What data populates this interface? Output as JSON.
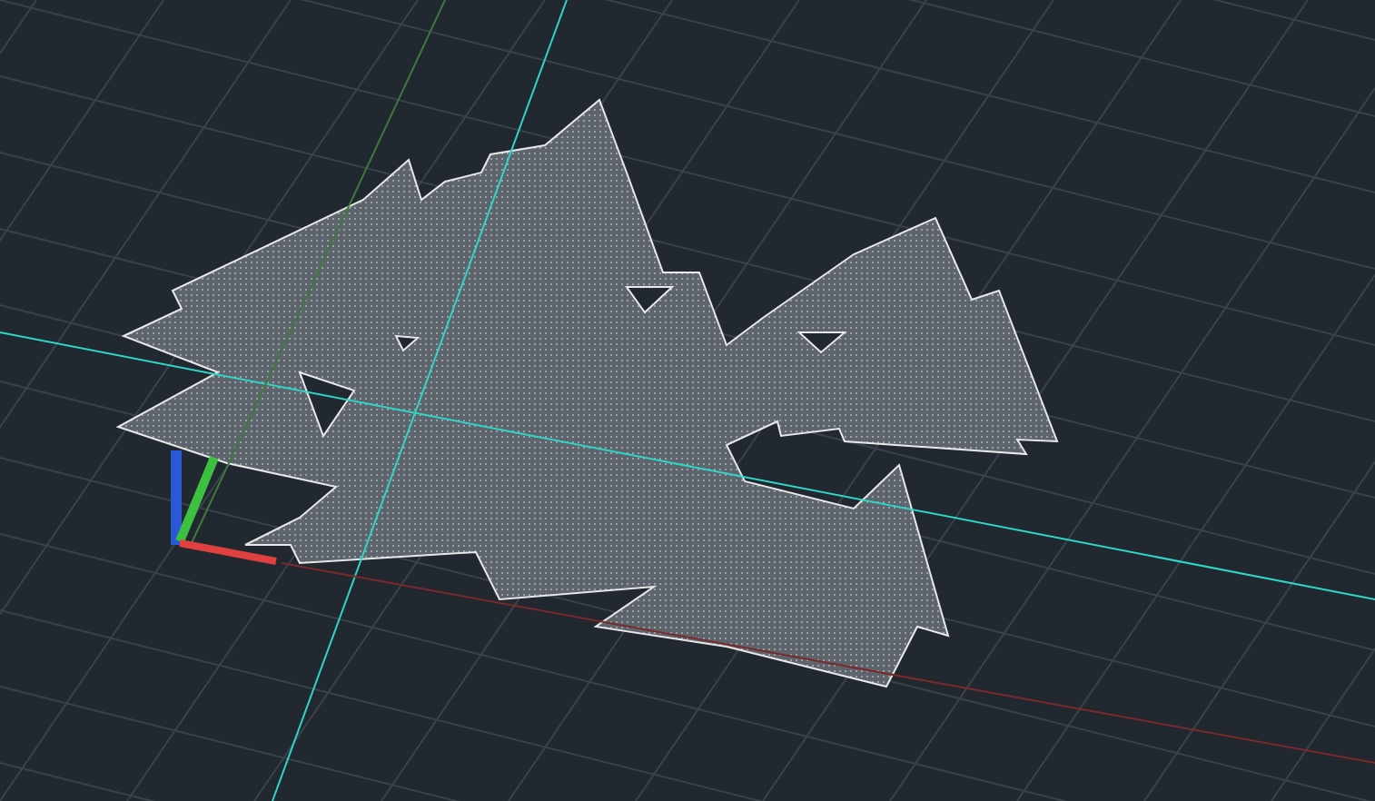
{
  "viewport": {
    "grid_visible": true,
    "ucs_icon_visible": true
  }
}
